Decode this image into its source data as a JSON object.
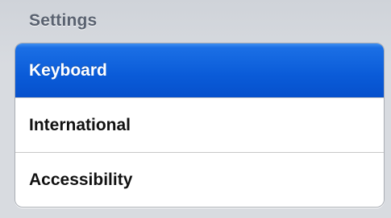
{
  "header": {
    "title": "Settings"
  },
  "list": {
    "items": [
      {
        "label": "Keyboard",
        "selected": true
      },
      {
        "label": "International",
        "selected": false
      },
      {
        "label": "Accessibility",
        "selected": false
      }
    ]
  },
  "colors": {
    "selected_background": "#0a5bd8",
    "selected_text": "#ffffff",
    "text": "#111111",
    "section_title": "#5a6270",
    "page_background": "#d8dbe0"
  }
}
